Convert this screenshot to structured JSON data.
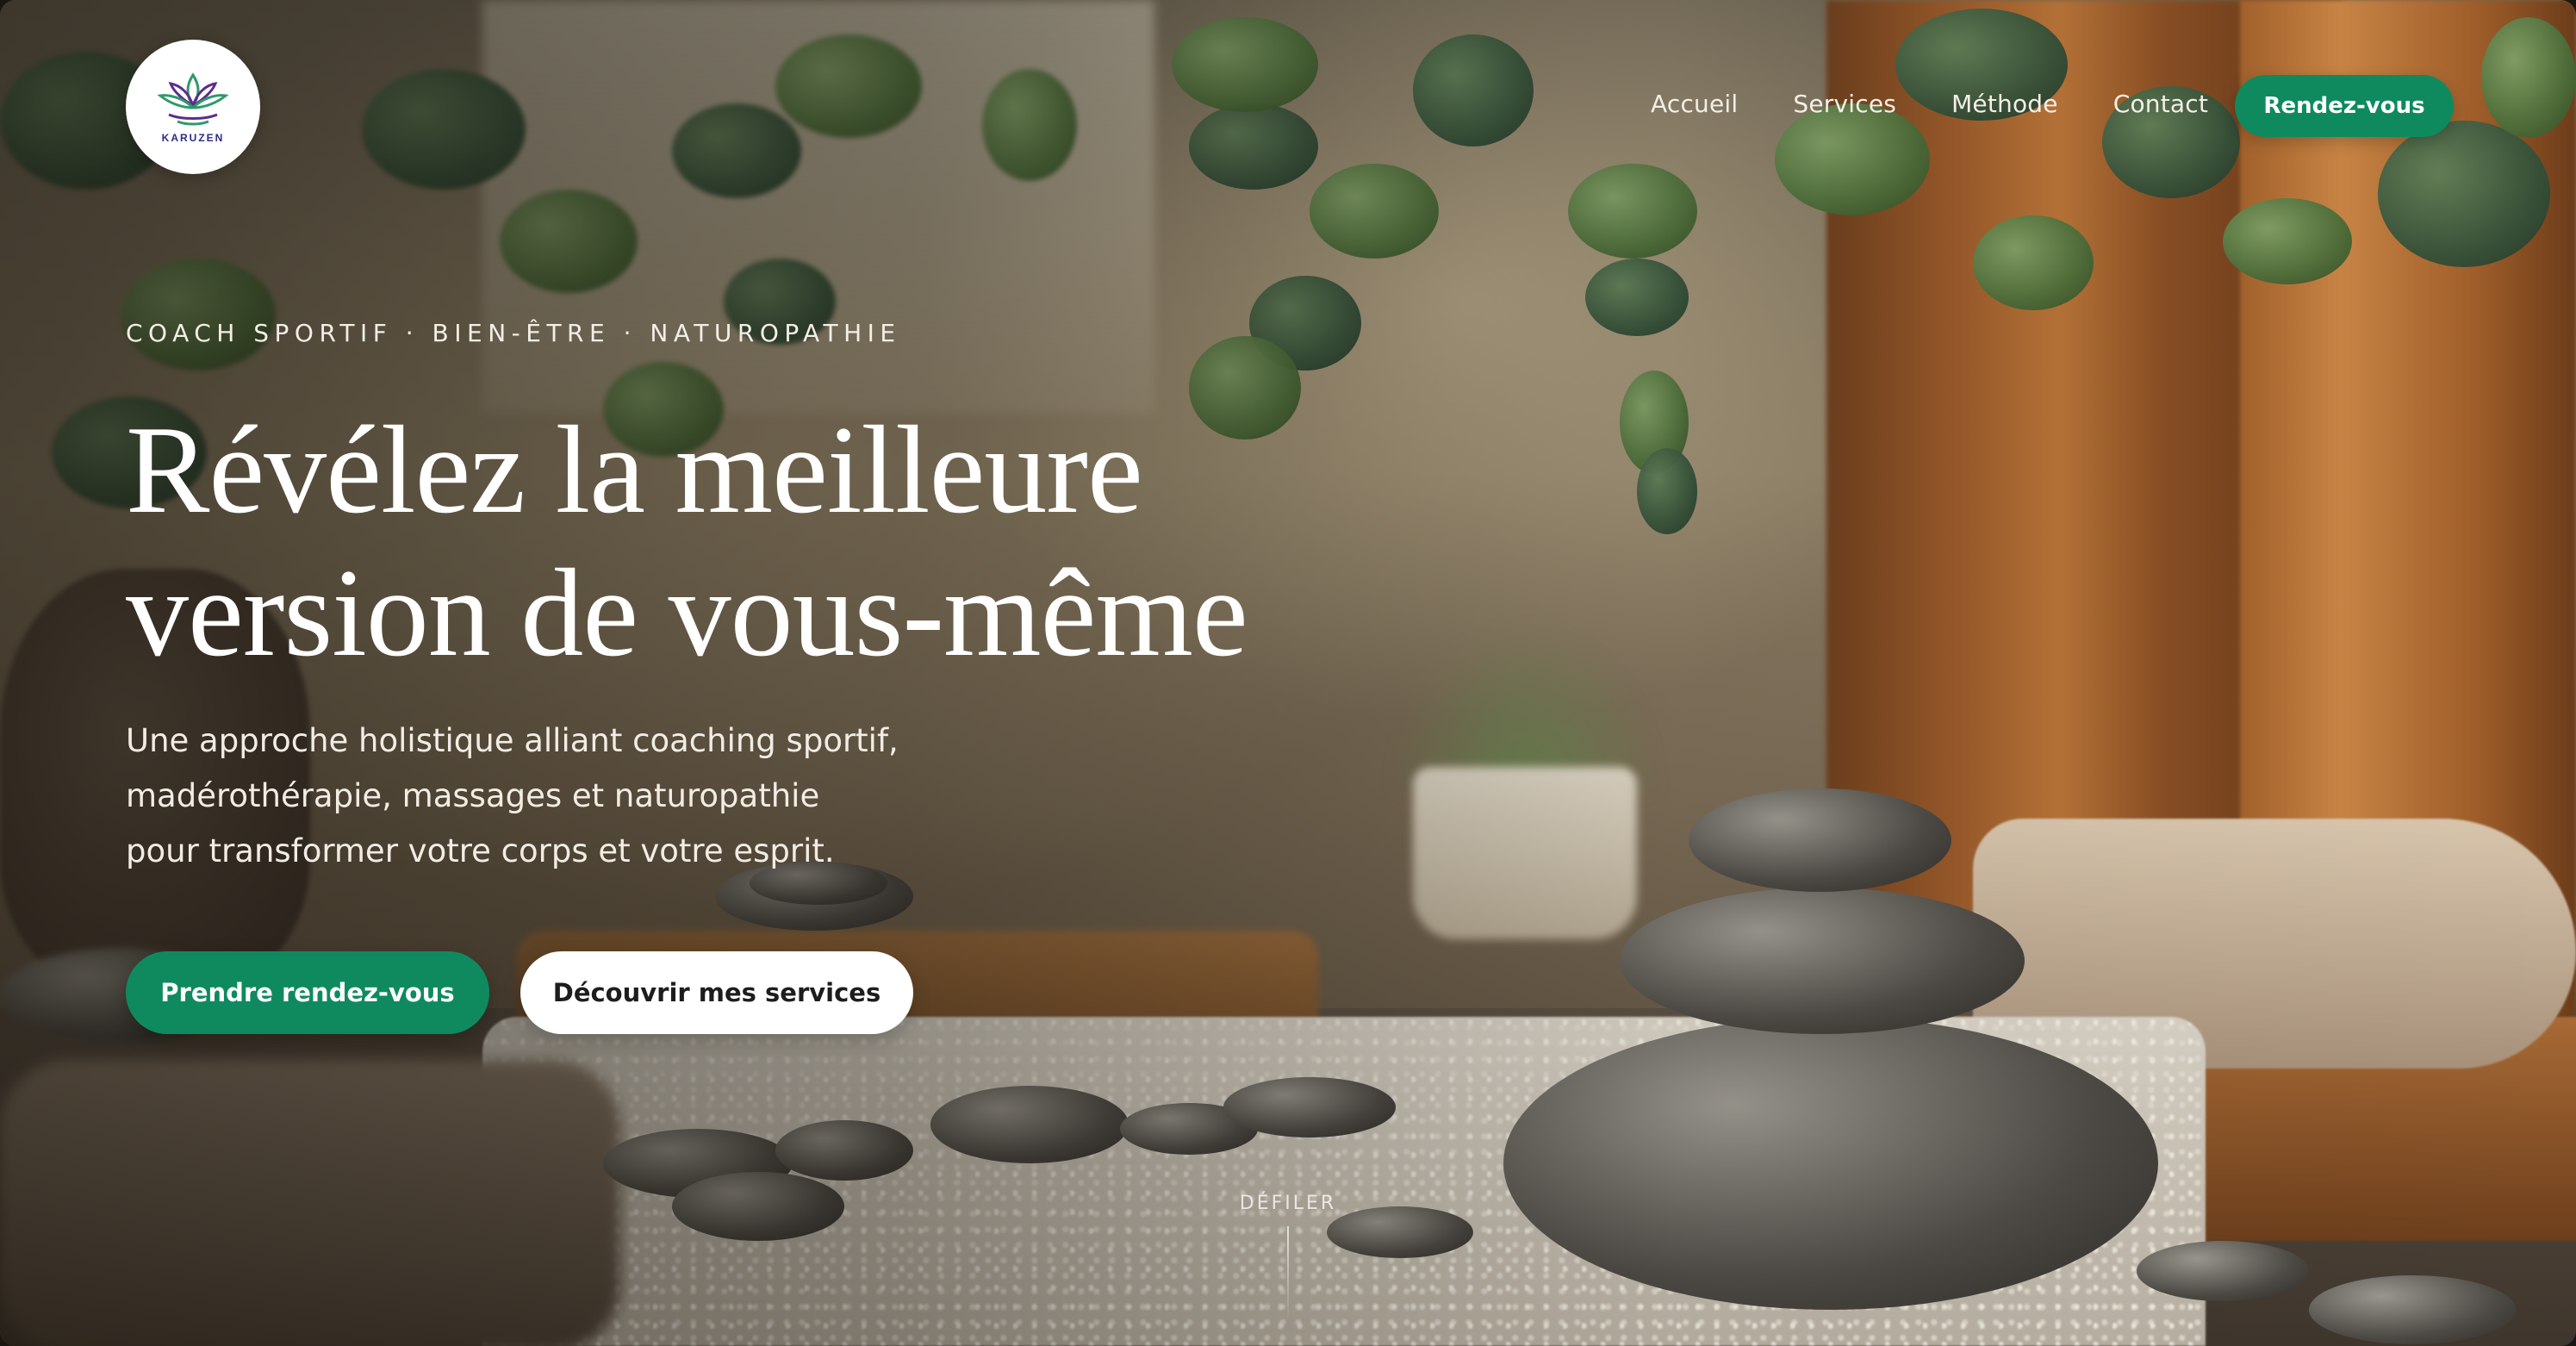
{
  "brand": {
    "name": "KARUZEN",
    "logo_icon": "lotus-icon",
    "colors": {
      "lotus_purple": "#5b2d8e",
      "lotus_green": "#2f9a6a",
      "text_navy": "#2c2a8a"
    }
  },
  "nav": {
    "items": [
      {
        "label": "Accueil"
      },
      {
        "label": "Services"
      },
      {
        "label": "Méthode"
      },
      {
        "label": "Contact"
      }
    ],
    "cta_label": "Rendez-vous"
  },
  "hero": {
    "eyebrow": "COACH SPORTIF · BIEN-ÊTRE · NATUROPATHIE",
    "headline_line1": "Révélez la meilleure",
    "headline_line2": "version de vous-même",
    "subtitle": "Une approche holistique alliant coaching sportif, madérothérapie, massages et naturopathie pour transformer votre corps et votre esprit.",
    "primary_button": "Prendre rendez-vous",
    "secondary_button": "Découvrir mes services"
  },
  "scroll_indicator": {
    "label": "DÉFILER"
  },
  "theme": {
    "accent": "#0f8a5f",
    "text_light": "#ffffff",
    "button_light_bg": "#ffffff"
  }
}
